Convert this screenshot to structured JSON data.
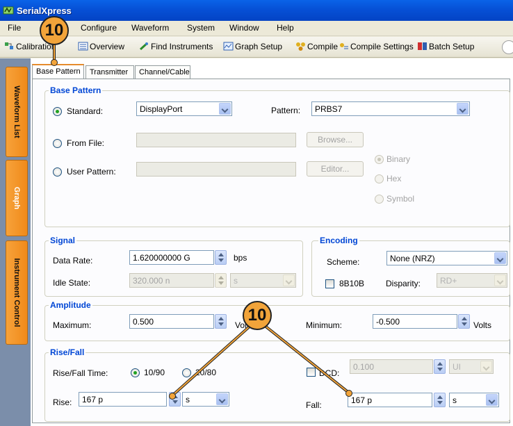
{
  "app": {
    "title": "SerialXpress"
  },
  "menu": [
    "File",
    "Configure",
    "Waveform",
    "System",
    "Window",
    "Help"
  ],
  "toolbar": {
    "calibration": "Calibration",
    "overview": "Overview",
    "find_instruments": "Find Instruments",
    "graph_setup": "Graph Setup",
    "compile": "Compile",
    "compile_settings": "Compile Settings",
    "batch_setup": "Batch Setup"
  },
  "sidebar": [
    "Waveform List",
    "Graph",
    "Instrument Control"
  ],
  "tabs": [
    "Base Pattern",
    "Transmitter",
    "Channel/Cable"
  ],
  "base_pattern": {
    "legend": "Base Pattern",
    "standard_label": "Standard:",
    "standard_value": "DisplayPort",
    "pattern_label": "Pattern:",
    "pattern_value": "PRBS7",
    "from_file_label": "From File:",
    "browse": "Browse...",
    "user_pattern_label": "User Pattern:",
    "editor": "Editor...",
    "binary": "Binary",
    "hex": "Hex",
    "symbol": "Symbol"
  },
  "signal": {
    "legend": "Signal",
    "data_rate_label": "Data Rate:",
    "data_rate_value": "1.620000000 G",
    "data_rate_unit": "bps",
    "idle_state_label": "Idle State:",
    "idle_state_value": "320.000 n",
    "idle_state_unit": "s"
  },
  "encoding": {
    "legend": "Encoding",
    "scheme_label": "Scheme:",
    "scheme_value": "None (NRZ)",
    "b8b10b_label": "8B10B",
    "disparity_label": "Disparity:",
    "disparity_value": "RD+"
  },
  "amplitude": {
    "legend": "Amplitude",
    "maximum_label": "Maximum:",
    "maximum_value": "0.500",
    "maximum_unit": "Volts",
    "minimum_label": "Minimum:",
    "minimum_value": "-0.500",
    "minimum_unit": "Volts"
  },
  "risefall": {
    "legend": "Rise/Fall",
    "time_label": "Rise/Fall Time:",
    "opt_1090": "10/90",
    "opt_2080": "20/80",
    "dcd_label": "DCD:",
    "dcd_value": "0.100",
    "dcd_unit": "UI",
    "rise_label": "Rise:",
    "rise_value": "167 p",
    "rise_unit": "s",
    "fall_label": "Fall:",
    "fall_value": "167 p",
    "fall_unit": "s"
  },
  "callouts": {
    "top": "10",
    "bottom": "10"
  },
  "colors": {
    "titlebar": "#0650d6",
    "accent": "#f2a43a",
    "legend": "#0046d5"
  }
}
